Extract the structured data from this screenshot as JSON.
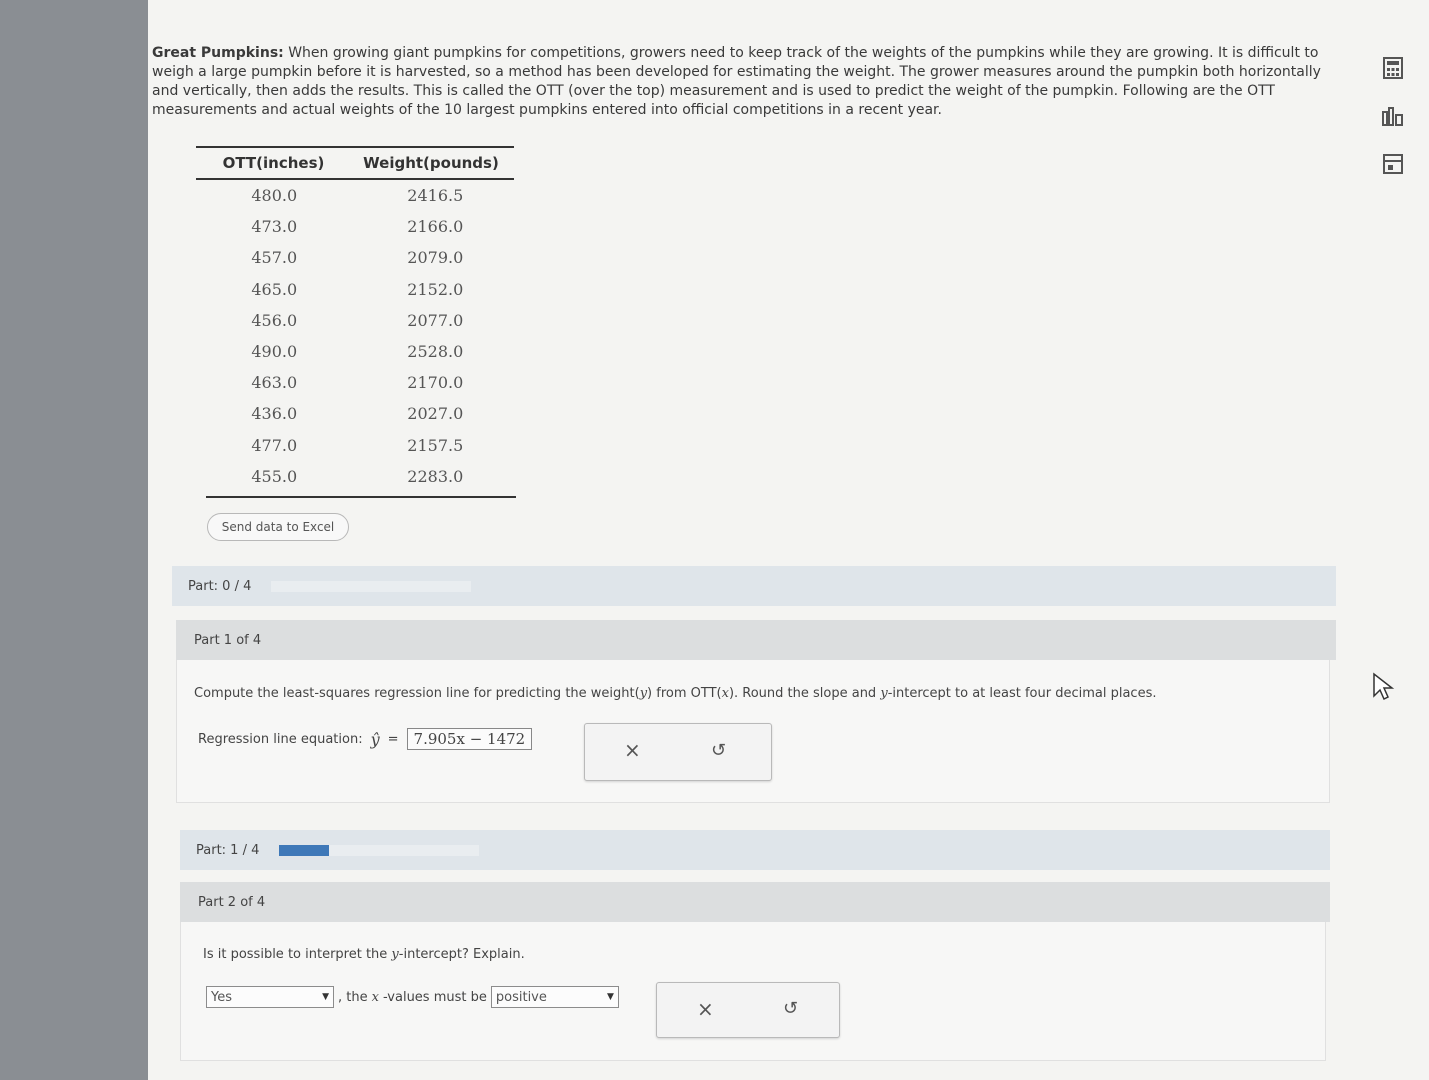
{
  "problem": {
    "title": "Great Pumpkins:",
    "text": "When growing giant pumpkins for competitions, growers need to keep track of the weights of the pumpkins while they are growing. It is difficult to weigh a large pumpkin before it is harvested, so a method has been developed for estimating the weight. The grower measures around the pumpkin both horizontally and vertically, then adds the results. This is called the OTT (over the top) measurement and is used to predict the weight of the pumpkin. Following are the OTT measurements and actual weights of the 10 largest pumpkins entered into official competitions in a recent year."
  },
  "table": {
    "headers": [
      "OTT(inches)",
      "Weight(pounds)"
    ],
    "rows": [
      [
        "480.0",
        "2416.5"
      ],
      [
        "473.0",
        "2166.0"
      ],
      [
        "457.0",
        "2079.0"
      ],
      [
        "465.0",
        "2152.0"
      ],
      [
        "456.0",
        "2077.0"
      ],
      [
        "490.0",
        "2528.0"
      ],
      [
        "463.0",
        "2170.0"
      ],
      [
        "436.0",
        "2027.0"
      ],
      [
        "477.0",
        "2157.5"
      ],
      [
        "455.0",
        "2283.0"
      ]
    ]
  },
  "excel_button": "Send data to Excel",
  "progress1": {
    "label": "Part: 0 / 4",
    "fraction": 0.0
  },
  "part1": {
    "header": "Part 1 of 4",
    "question_a": "Compute the least-squares regression line for predicting the weight(",
    "question_y": "y",
    "question_b": ") from OTT(",
    "question_x": "x",
    "question_c": "). Round the slope and ",
    "question_y2": "y",
    "question_d": "-intercept to at least four decimal places.",
    "equation_label": "Regression line equation:",
    "yhat": "ŷ",
    "equals": "=",
    "answer": "7.905x − 1472"
  },
  "progress2": {
    "label": "Part: 1 / 4",
    "fraction": 0.25
  },
  "part2": {
    "header": "Part 2 of 4",
    "question_a": "Is it possible to interpret the ",
    "question_y": "y",
    "question_b": "-intercept? Explain.",
    "select1": "Yes",
    "middle_a": ", the ",
    "middle_x": "x",
    "middle_b": "-values must be",
    "select2": "positive"
  },
  "icons": {
    "clear": "×",
    "undo": "↺"
  }
}
